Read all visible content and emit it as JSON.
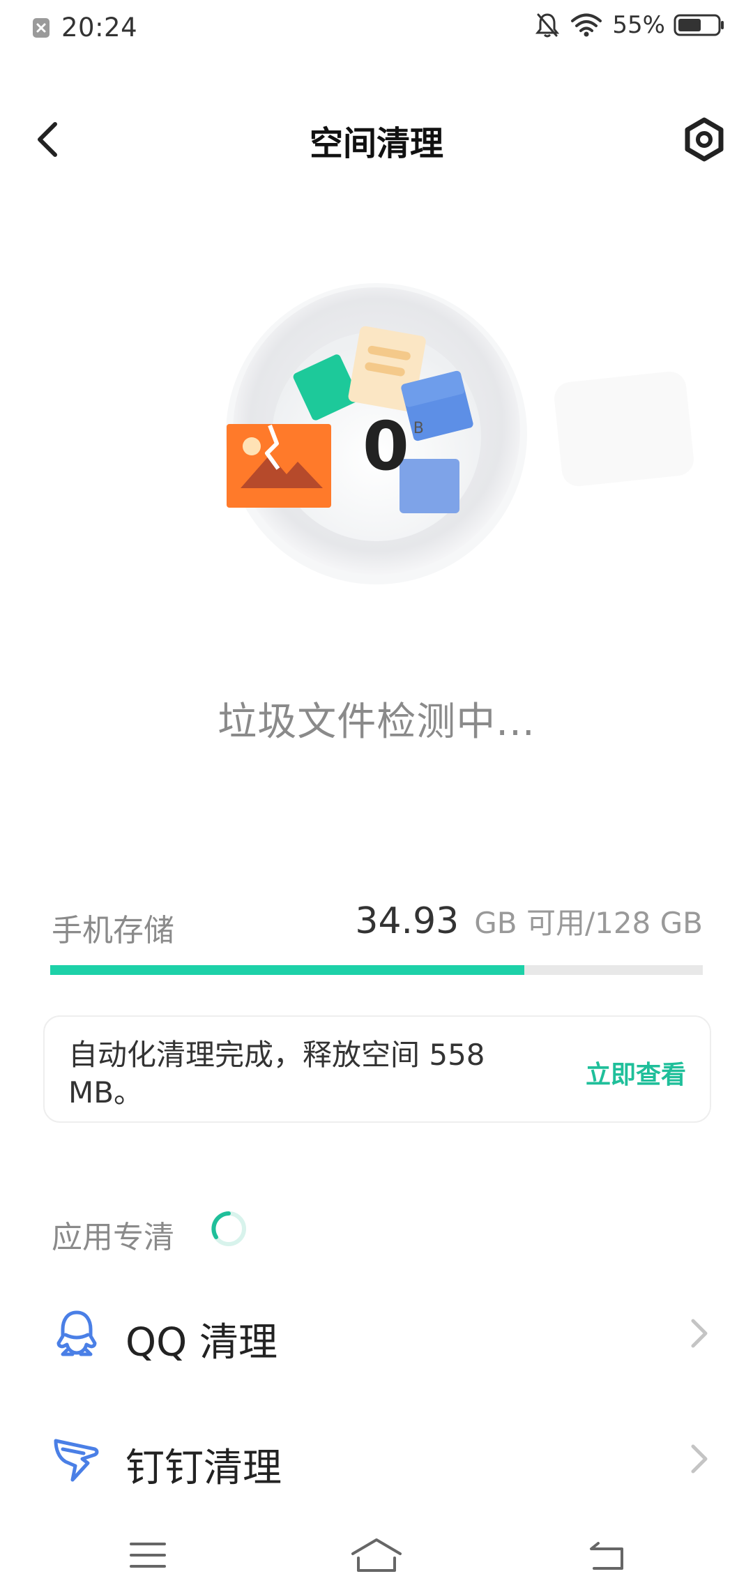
{
  "status_bar": {
    "time": "20:24",
    "battery": "55%",
    "icons": [
      "notification-icon",
      "silent-bell-icon",
      "wifi-icon",
      "battery-icon"
    ]
  },
  "header": {
    "title": "空间清理",
    "back_icon": "chevron-left-icon",
    "settings_icon": "settings-icon"
  },
  "scan": {
    "size_value": "0",
    "size_unit": "B",
    "status": "垃圾文件检测中..."
  },
  "storage": {
    "label": "手机存储",
    "available": "34.93",
    "rest": "GB 可用/128 GB",
    "used_fraction": 0.727,
    "bar_color": "#1dd1a8"
  },
  "notice": {
    "text": "自动化清理完成，释放空间 558 MB。",
    "link": "立即查看",
    "link_color": "#1fbf9a"
  },
  "apps_section": {
    "label": "应用专清",
    "items": [
      {
        "label": "QQ 清理",
        "icon": "qq-icon"
      },
      {
        "label": "钉钉清理",
        "icon": "dingtalk-icon"
      }
    ]
  },
  "nav": {
    "icons": [
      "menu-icon",
      "home-icon",
      "back-icon"
    ]
  }
}
